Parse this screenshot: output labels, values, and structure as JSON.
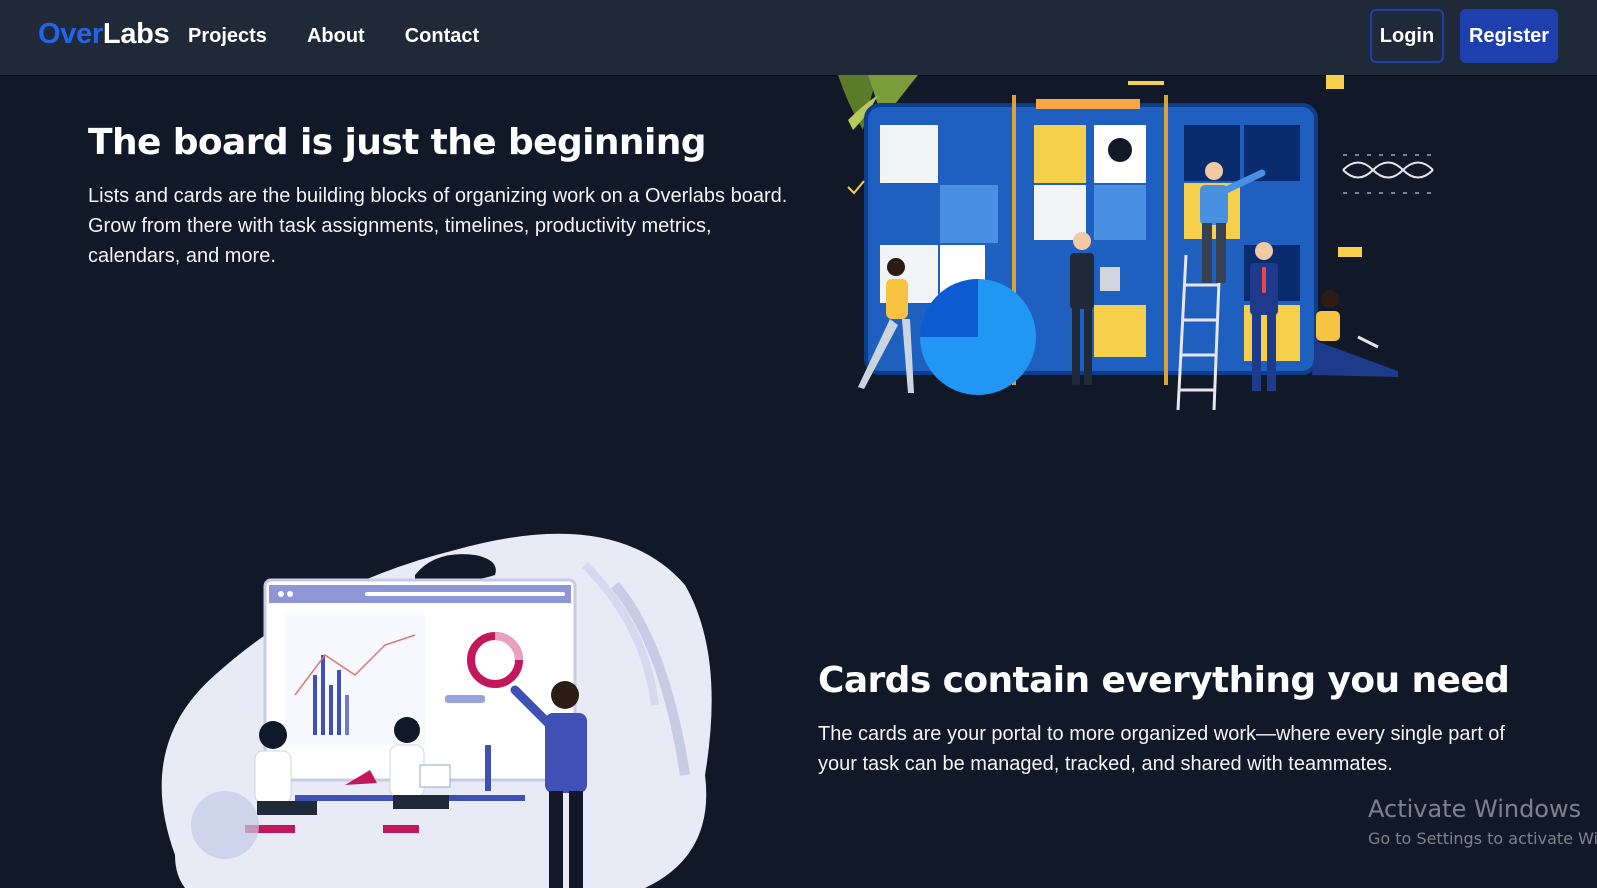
{
  "nav": {
    "brand_over": "Over",
    "brand_labs": "Labs",
    "links": [
      "Projects",
      "About",
      "Contact"
    ],
    "login_label": "Login",
    "register_label": "Register"
  },
  "section_board": {
    "title": "The board is just the beginning",
    "text": "Lists and cards are the building blocks of organizing work on a Overlabs board. Grow from there with task assignments, timelines, productivity metrics, calendars, and more."
  },
  "section_cards": {
    "title": "Cards contain everything you need",
    "text": "The cards are your portal to more organized work—where every single part of your task can be managed, tracked, and shared with teammates."
  },
  "watermark": {
    "title": "Activate Windows",
    "subtitle": "Go to Settings to activate Wi"
  },
  "colors": {
    "background": "#111827",
    "navbar": "#1f2937",
    "brand_accent": "#2563eb",
    "button": "#1e40af"
  }
}
